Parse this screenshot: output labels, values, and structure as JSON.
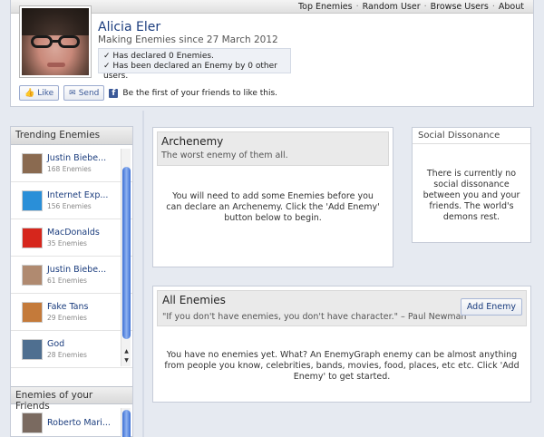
{
  "nav": {
    "items": [
      "Top Enemies",
      "Random User",
      "Browse Users",
      "About"
    ],
    "separator": "·"
  },
  "profile": {
    "name": "Alicia Eler",
    "since": "Making Enemies since 27 March 2012",
    "stats": [
      "✓ Has declared 0 Enemies.",
      "✓ Has been declared an Enemy by 0 other users."
    ]
  },
  "social": {
    "like_label": "Like",
    "send_label": "Send",
    "fb_logo": "f",
    "like_text": "Be the first of your friends to like this."
  },
  "sidebar": {
    "trending_title": "Trending Enemies",
    "trending": [
      {
        "name": "Justin Biebe...",
        "count": "168 Enemies",
        "icon": "person-photo",
        "color": "#8a6a50"
      },
      {
        "name": "Internet Exp...",
        "count": "156 Enemies",
        "icon": "ie-logo",
        "color": "#2a8fd8"
      },
      {
        "name": "MacDonalds",
        "count": "35 Enemies",
        "icon": "mcdonalds-logo",
        "color": "#d6261c"
      },
      {
        "name": "Justin Biebe...",
        "count": "61 Enemies",
        "icon": "person-photo",
        "color": "#b08a70"
      },
      {
        "name": "Fake Tans",
        "count": "29 Enemies",
        "icon": "fake-tans-photo",
        "color": "#c47a3a"
      },
      {
        "name": "God",
        "count": "28 Enemies",
        "icon": "sky-photo",
        "color": "#4f6f90"
      }
    ],
    "friends_title": "Enemies of your Friends",
    "friends": [
      {
        "name": "Roberto Mari...",
        "icon": "person-photo",
        "color": "#7a6a60"
      }
    ]
  },
  "archenemy": {
    "title": "Archenemy",
    "subtitle": "The worst enemy of them all.",
    "body": "You will need to add some Enemies before you can declare an Archenemy. Click the 'Add Enemy' button below to begin."
  },
  "dissonance": {
    "title": "Social Dissonance",
    "body": "There is currently no social dissonance between you and your friends. The world's demons rest."
  },
  "all_enemies": {
    "title": "All Enemies",
    "quote": "\"If you don't have enemies, you don't have character.\" – Paul Newman",
    "add_button": "Add Enemy",
    "body": "You have no enemies yet. What? An EnemyGraph enemy can be almost anything from people you know, celebrities, bands, movies, food, places, etc etc. Click 'Add Enemy' to get started."
  }
}
